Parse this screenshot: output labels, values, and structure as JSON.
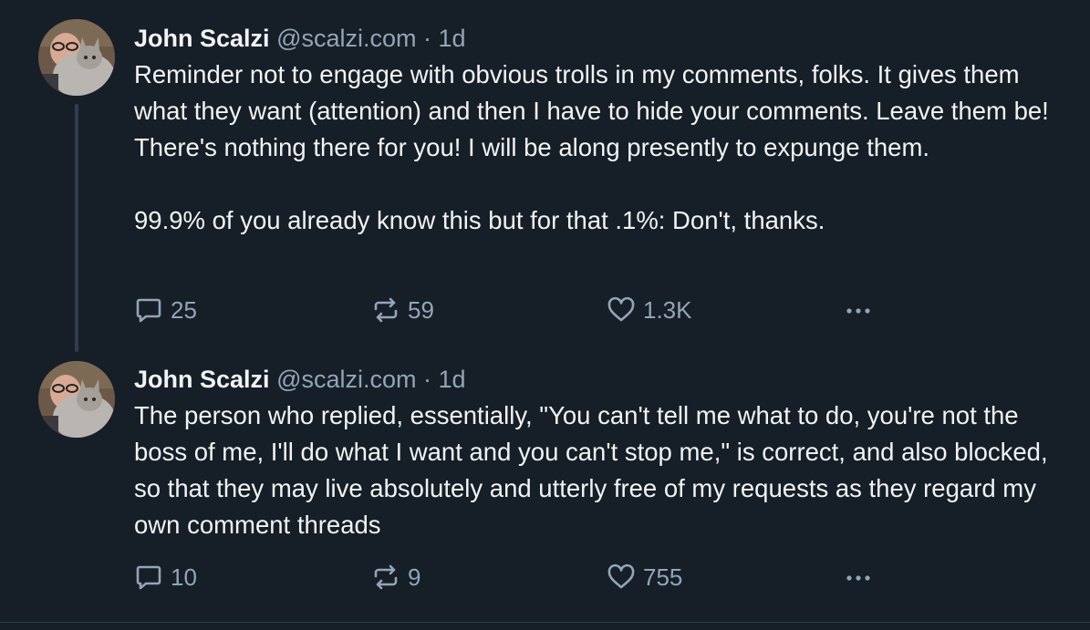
{
  "posts": [
    {
      "author_name": "John Scalzi",
      "handle": "@scalzi.com",
      "separator": "·",
      "time": "1d",
      "text": "Reminder not to engage with obvious trolls in my comments, folks. It gives them what they want (attention) and then I have to hide your comments. Leave them be! There's nothing there for you! I will be along presently to expunge them.\n\n99.9% of you already know this but for that .1%: Don't, thanks.",
      "reply_count": "25",
      "repost_count": "59",
      "like_count": "1.3K"
    },
    {
      "author_name": "John Scalzi",
      "handle": "@scalzi.com",
      "separator": "·",
      "time": "1d",
      "text": "The person who replied, essentially, \"You can't tell me what to do, you're not the boss of me, I'll do what I want and you can't stop me,\" is correct, and also blocked, so that they may live absolutely and utterly free of my requests as they regard my own comment threads",
      "reply_count": "10",
      "repost_count": "9",
      "like_count": "755"
    }
  ],
  "icons": {
    "reply": "reply-icon",
    "repost": "repost-icon",
    "like": "heart-icon",
    "more": "more-icon",
    "avatar": "avatar-photo"
  },
  "colors": {
    "background": "#161e27",
    "text_primary": "#f1f3f5",
    "text_secondary": "#93a5b7",
    "thread_line": "#2e3e50"
  }
}
